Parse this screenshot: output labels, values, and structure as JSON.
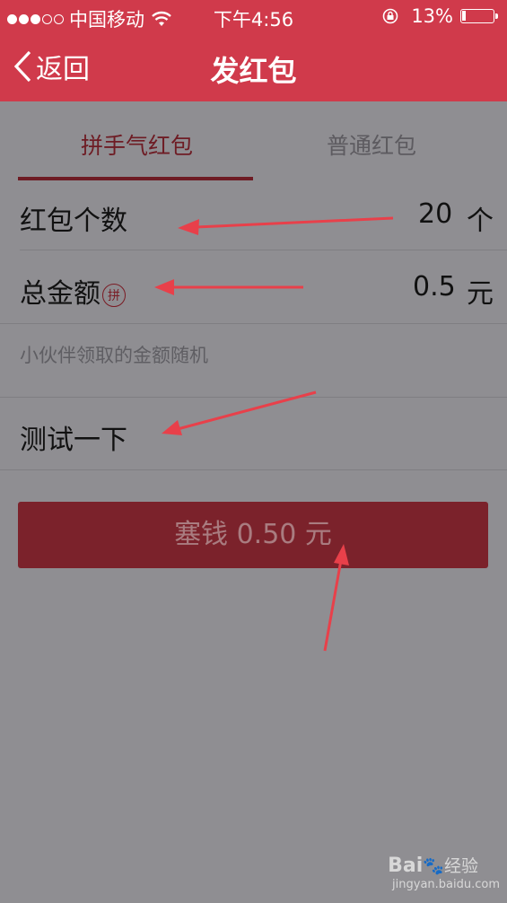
{
  "status_bar": {
    "carrier": "中国移动",
    "time": "下午4:56",
    "battery_percent": "13%",
    "battery_level": 0.13,
    "signal_filled": 3,
    "signal_total": 5
  },
  "nav": {
    "back_label": "返回",
    "title": "发红包"
  },
  "tabs": [
    {
      "label": "拼手气红包",
      "active": true
    },
    {
      "label": "普通红包",
      "active": false
    }
  ],
  "form": {
    "count_label": "红包个数",
    "count_value": "20",
    "count_unit": "个",
    "amount_label": "总金额",
    "amount_badge": "拼",
    "amount_value": "0.5",
    "amount_unit": "元",
    "hint": "小伙伴领取的金额随机",
    "message": "测试一下"
  },
  "send_button": "塞钱 0.50 元",
  "watermark": {
    "brand": "Bai",
    "brand_suffix": "经验",
    "url": "jingyan.baidu.com"
  },
  "colors": {
    "header": "#d03a4b",
    "button": "#7b222b",
    "overlay_bg": "#8f8e92",
    "arrow": "#e8404a"
  }
}
